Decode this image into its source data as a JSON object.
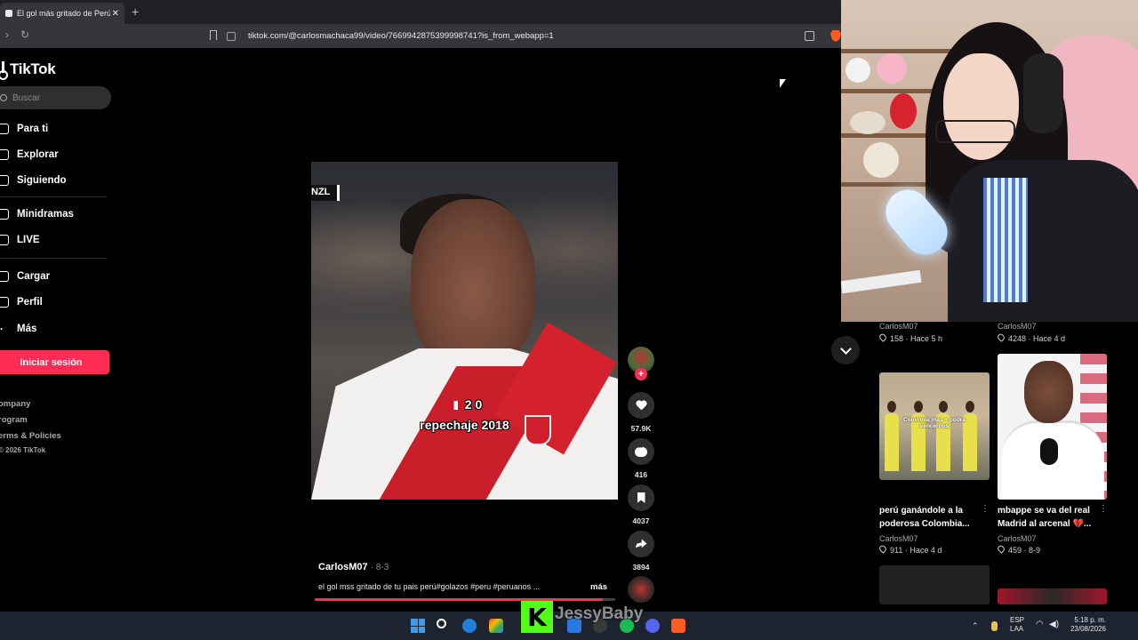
{
  "browser": {
    "tab_title": "El gol más gritado de Perú: Pe",
    "url": "tiktok.com/@carlosmachaca99/video/7669942875399998741?is_from_webapp=1"
  },
  "sidebar": {
    "logo": "TikTok",
    "search_placeholder": "Buscar",
    "items": [
      {
        "label": "Para ti",
        "icon": "home-icon"
      },
      {
        "label": "Explorar",
        "icon": "compass-icon"
      },
      {
        "label": "Siguiendo",
        "icon": "following-icon"
      },
      {
        "label": "Minidramas",
        "icon": "drama-icon"
      },
      {
        "label": "LIVE",
        "icon": "live-icon"
      },
      {
        "label": "Cargar",
        "icon": "upload-icon"
      },
      {
        "label": "Perfil",
        "icon": "profile-icon"
      },
      {
        "label": "Más",
        "icon": "more-icon"
      }
    ],
    "login_label": "Iniciar sesión",
    "footer": [
      "ompany",
      "rogram",
      "erms & Policies",
      "© 2026 TikTok"
    ]
  },
  "video": {
    "score_tag": "NZL",
    "overlay_score": "2 0",
    "overlay_text": "repechaje 2018",
    "author": "CarlosM07",
    "date": "· 8-3",
    "caption": "el gol mss gritado de tu pais perú#golazos #peru #peruanos ...",
    "more_label": "más",
    "progress_fraction": 0.96
  },
  "actions": {
    "likes": "57.9K",
    "comments": "416",
    "saves": "4037",
    "shares": "3894"
  },
  "recommended": {
    "row1": [
      {
        "author": "CarlosM07",
        "likes": "158",
        "time": "Hace 5 h"
      },
      {
        "author": "CarlosM07",
        "likes": "4248",
        "time": "Hace 4 d"
      }
    ],
    "row2": [
      {
        "thumb_caption": "Colombia mas + podra vencernos",
        "title": "perú ganándole a la poderosa Colombia...",
        "author": "CarlosM07",
        "likes": "911",
        "time": "Hace 4 d"
      },
      {
        "title": "mbappe se va del real Madrid al arcenal 💔...",
        "author": "CarlosM07",
        "likes": "459",
        "time": "8-9"
      }
    ]
  },
  "stream_overlay": {
    "streamer_name": "JessyBaby",
    "kick_letter": "K",
    "kick_color": "#53fc18"
  },
  "taskbar": {
    "lang_top": "ESP",
    "lang_bottom": "LAA",
    "time": "5:18 p. m.",
    "date": "23/08/2026"
  },
  "colors": {
    "accent": "#fe2c55",
    "browser_bg": "#202124"
  }
}
